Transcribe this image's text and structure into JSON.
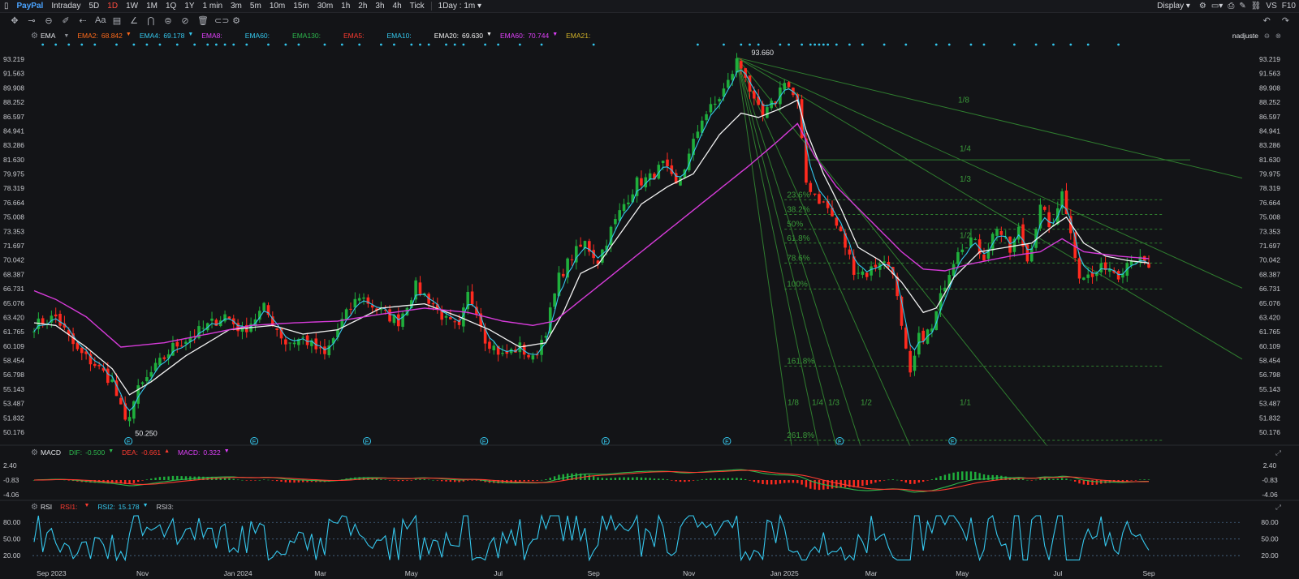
{
  "topbar": {
    "symbol": "PayPal",
    "timeframes": [
      "Intraday",
      "5D",
      "1D",
      "1W",
      "1M",
      "1Q",
      "1Y",
      "1 min",
      "3m",
      "5m",
      "10m",
      "15m",
      "30m",
      "1h",
      "2h",
      "3h",
      "4h",
      "Tick"
    ],
    "active_timeframe": "1D",
    "interval": "1Day : 1m",
    "display": "Display",
    "vs_label": "VS",
    "f10_label": "F10"
  },
  "main_legend": {
    "indicator": "EMA",
    "items": [
      {
        "label": "EMA2:",
        "value": "68.842",
        "color": "#ff6a1a",
        "arrow": "▼"
      },
      {
        "label": "EMA4:",
        "value": "69.178",
        "color": "#35c8ee",
        "arrow": "▼"
      },
      {
        "label": "EMA8:",
        "value": "",
        "color": "#e040fb",
        "arrow": ""
      },
      {
        "label": "EMA60:",
        "value": "",
        "color": "#35c8ee",
        "arrow": ""
      },
      {
        "label": "EMA130:",
        "value": "",
        "color": "#2db84d",
        "arrow": ""
      },
      {
        "label": "EMA5:",
        "value": "",
        "color": "#ff3b30",
        "arrow": ""
      },
      {
        "label": "EMA10:",
        "value": "",
        "color": "#35c8ee",
        "arrow": ""
      },
      {
        "label": "EMA20:",
        "value": "69.630",
        "color": "#f2f2f2",
        "arrow": "▼"
      },
      {
        "label": "EMA60:",
        "value": "70.744",
        "color": "#e040fb",
        "arrow": "▼"
      },
      {
        "label": "EMA21:",
        "value": "",
        "color": "#d4b429",
        "arrow": ""
      }
    ],
    "adjust_label": "nadjuste"
  },
  "macd_legend": {
    "indicator": "MACD",
    "items": [
      {
        "label": "DIF:",
        "value": "-0.500",
        "color": "#2db84d",
        "arrow": "▼"
      },
      {
        "label": "DEA:",
        "value": "-0.661",
        "color": "#ff3b30",
        "arrow": "▲"
      },
      {
        "label": "MACD:",
        "value": "0.322",
        "color": "#e040fb",
        "arrow": "▼"
      }
    ]
  },
  "rsi_legend": {
    "indicator": "RSI",
    "items": [
      {
        "label": "RSI1:",
        "value": "",
        "color": "#ff3b30",
        "arrow": "▼"
      },
      {
        "label": "RSI2:",
        "value": "15.178",
        "color": "#35c8ee",
        "arrow": "▼"
      },
      {
        "label": "RSI3:",
        "value": "",
        "color": "#c9cbd1",
        "arrow": ""
      }
    ]
  },
  "chart_data": {
    "type": "line",
    "title": "PayPal 1D",
    "y_ticks": [
      "93.219",
      "91.563",
      "89.908",
      "88.252",
      "86.597",
      "84.941",
      "83.286",
      "81.630",
      "79.975",
      "78.319",
      "76.664",
      "75.008",
      "73.353",
      "71.697",
      "70.042",
      "68.387",
      "66.731",
      "65.076",
      "63.420",
      "61.765",
      "60.109",
      "58.454",
      "56.798",
      "55.143",
      "53.487",
      "51.832",
      "50.176"
    ],
    "ylim": [
      50.176,
      93.219
    ],
    "x_labels": [
      "Sep 2023",
      "Nov",
      "Jan 2024",
      "Mar",
      "May",
      "Jul",
      "Sep",
      "Nov",
      "Jan 2025",
      "Mar",
      "May",
      "Jul",
      "Sep"
    ],
    "x_index": [
      4,
      25,
      47,
      66,
      87,
      107,
      129,
      151,
      173,
      193,
      214,
      236,
      257
    ],
    "n_bars": 258,
    "high_label": "93.660",
    "low_label": "50.250",
    "price_anchors": [
      [
        0,
        62.5
      ],
      [
        5,
        63.5
      ],
      [
        10,
        59.5
      ],
      [
        14,
        58
      ],
      [
        18,
        56
      ],
      [
        21,
        51.2
      ],
      [
        24,
        55
      ],
      [
        27,
        57
      ],
      [
        32,
        60
      ],
      [
        37,
        61.5
      ],
      [
        44,
        63.7
      ],
      [
        48,
        61.8
      ],
      [
        53,
        64.5
      ],
      [
        58,
        60.5
      ],
      [
        62,
        61
      ],
      [
        67,
        59
      ],
      [
        71,
        63
      ],
      [
        75,
        66
      ],
      [
        80,
        64
      ],
      [
        84,
        63
      ],
      [
        88,
        67
      ],
      [
        92,
        65
      ],
      [
        95,
        63
      ],
      [
        98,
        62
      ],
      [
        100,
        66
      ],
      [
        102,
        64.5
      ],
      [
        104,
        61
      ],
      [
        108,
        59
      ],
      [
        112,
        60
      ],
      [
        115,
        58.5
      ],
      [
        118,
        62
      ],
      [
        121,
        68
      ],
      [
        124,
        70.5
      ],
      [
        127,
        72
      ],
      [
        130,
        70
      ],
      [
        133,
        73.5
      ],
      [
        136,
        76.5
      ],
      [
        139,
        79
      ],
      [
        142,
        79.5
      ],
      [
        145,
        81
      ],
      [
        148,
        78.5
      ],
      [
        151,
        82
      ],
      [
        154,
        86.5
      ],
      [
        157,
        88
      ],
      [
        160,
        90.5
      ],
      [
        162,
        93
      ],
      [
        164,
        91.5
      ],
      [
        166,
        88
      ],
      [
        168,
        86.5
      ],
      [
        171,
        88.5
      ],
      [
        173,
        91
      ],
      [
        175,
        89
      ],
      [
        176,
        88
      ],
      [
        178,
        79
      ],
      [
        181,
        77
      ],
      [
        183,
        76
      ],
      [
        186,
        73
      ],
      [
        189,
        69
      ],
      [
        192,
        68.5
      ],
      [
        195,
        70
      ],
      [
        198,
        69
      ],
      [
        200,
        62
      ],
      [
        202,
        56.5
      ],
      [
        204,
        61
      ],
      [
        207,
        62
      ],
      [
        210,
        67.5
      ],
      [
        213,
        71.5
      ],
      [
        216,
        72.5
      ],
      [
        219,
        70.5
      ],
      [
        222,
        74
      ],
      [
        225,
        71
      ],
      [
        227,
        73.5
      ],
      [
        229,
        70
      ],
      [
        232,
        76
      ],
      [
        235,
        73.5
      ],
      [
        237,
        78.5
      ],
      [
        239,
        73
      ],
      [
        241,
        68.5
      ],
      [
        244,
        68
      ],
      [
        247,
        69.5
      ],
      [
        250,
        68.5
      ],
      [
        253,
        70.5
      ],
      [
        256,
        69.5
      ],
      [
        257,
        68.8
      ]
    ],
    "ema_slow_anchors": [
      [
        0,
        66.5
      ],
      [
        5,
        65.5
      ],
      [
        12,
        63.5
      ],
      [
        20,
        60
      ],
      [
        30,
        60.5
      ],
      [
        40,
        61.5
      ],
      [
        50,
        62.5
      ],
      [
        60,
        62.8
      ],
      [
        70,
        63
      ],
      [
        80,
        63.8
      ],
      [
        90,
        64.5
      ],
      [
        100,
        64
      ],
      [
        108,
        63
      ],
      [
        115,
        62.5
      ],
      [
        120,
        63
      ],
      [
        125,
        65
      ],
      [
        135,
        69
      ],
      [
        145,
        73
      ],
      [
        155,
        77
      ],
      [
        165,
        81
      ],
      [
        172,
        84
      ],
      [
        176,
        85.8
      ],
      [
        180,
        82
      ],
      [
        185,
        78.5
      ],
      [
        190,
        76
      ],
      [
        195,
        73.5
      ],
      [
        200,
        71
      ],
      [
        205,
        69
      ],
      [
        210,
        68.8
      ],
      [
        215,
        69.5
      ],
      [
        225,
        70.5
      ],
      [
        232,
        71
      ],
      [
        237,
        72.5
      ],
      [
        242,
        71
      ],
      [
        250,
        70.5
      ],
      [
        257,
        70.2
      ]
    ],
    "ema_mid_anchors": [
      [
        0,
        62.8
      ],
      [
        5,
        62.5
      ],
      [
        12,
        60
      ],
      [
        18,
        57.5
      ],
      [
        22,
        54.5
      ],
      [
        27,
        56
      ],
      [
        35,
        59
      ],
      [
        45,
        62
      ],
      [
        55,
        62.5
      ],
      [
        62,
        61.5
      ],
      [
        70,
        62
      ],
      [
        80,
        64.5
      ],
      [
        90,
        65
      ],
      [
        98,
        63.5
      ],
      [
        105,
        62
      ],
      [
        112,
        60
      ],
      [
        118,
        60.5
      ],
      [
        122,
        64
      ],
      [
        126,
        68.5
      ],
      [
        130,
        69.5
      ],
      [
        135,
        73
      ],
      [
        140,
        76.5
      ],
      [
        146,
        78.5
      ],
      [
        152,
        80
      ],
      [
        158,
        84.5
      ],
      [
        163,
        87
      ],
      [
        167,
        86.5
      ],
      [
        172,
        87.5
      ],
      [
        176,
        88.5
      ],
      [
        178,
        85
      ],
      [
        182,
        80
      ],
      [
        186,
        76
      ],
      [
        190,
        71.5
      ],
      [
        195,
        70
      ],
      [
        200,
        67.5
      ],
      [
        205,
        64
      ],
      [
        208,
        64.5
      ],
      [
        212,
        68
      ],
      [
        218,
        71
      ],
      [
        224,
        71.5
      ],
      [
        230,
        72
      ],
      [
        235,
        74
      ],
      [
        238,
        75
      ],
      [
        242,
        72
      ],
      [
        247,
        70.5
      ],
      [
        252,
        70
      ],
      [
        257,
        69.7
      ]
    ],
    "fib_labels": [
      "23.6%",
      "38.2%",
      "50%",
      "61.8%",
      "78.6%",
      "100%",
      "161.8%",
      "261.8%"
    ],
    "fib_levels": [
      77.0,
      75.3,
      73.6,
      72.0,
      69.7,
      66.7,
      57.8,
      43.8
    ],
    "fan_labels": [
      "1/8",
      "1/4",
      "1/3",
      "1/2",
      "1/1"
    ],
    "fan_left_labels": [
      "1/8",
      "1/4",
      "1/3",
      "1/2"
    ],
    "macd_ticks": [
      "2.40",
      "-0.83",
      "-4.06"
    ],
    "macd_ylim": [
      -4.06,
      2.4
    ],
    "rsi_ticks": [
      "80.00",
      "50.00",
      "20.00"
    ],
    "rsi_ylim": [
      10,
      95
    ]
  }
}
